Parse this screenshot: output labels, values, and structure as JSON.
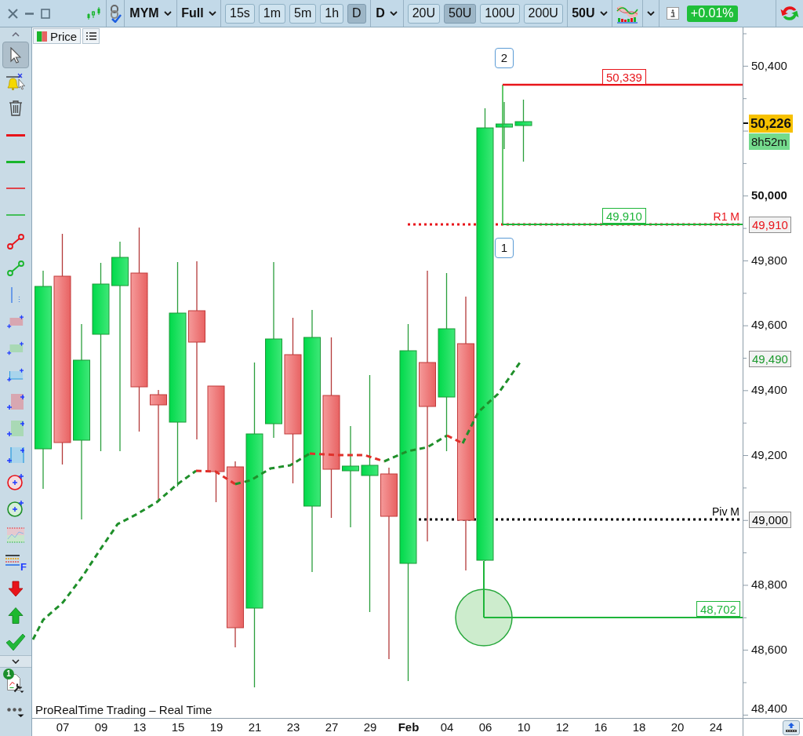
{
  "toolbar": {
    "instrument": "MYM",
    "view": "Full",
    "intervals": [
      {
        "label": "15s",
        "selected": false
      },
      {
        "label": "1m",
        "selected": false
      },
      {
        "label": "5m",
        "selected": false
      },
      {
        "label": "1h",
        "selected": false
      },
      {
        "label": "D",
        "selected": true
      }
    ],
    "period": "D",
    "units": [
      {
        "label": "20U",
        "selected": false
      },
      {
        "label": "50U",
        "selected": true
      },
      {
        "label": "100U",
        "selected": false
      },
      {
        "label": "200U",
        "selected": false
      }
    ],
    "unit_count": "50U",
    "change": "+0.01%"
  },
  "chart_tab": {
    "label": "Price"
  },
  "drawing_tools": [
    {
      "selected": true
    },
    {
      "selected": false
    },
    {
      "selected": false
    },
    {
      "selected": false
    },
    {
      "selected": false
    },
    {
      "selected": false
    },
    {
      "selected": false
    },
    {
      "selected": false
    },
    {
      "selected": false
    },
    {
      "selected": false
    },
    {
      "selected": false
    },
    {
      "selected": false
    },
    {
      "selected": false
    },
    {
      "selected": false
    },
    {
      "selected": false
    },
    {
      "selected": false
    },
    {
      "selected": false
    },
    {
      "selected": false
    },
    {
      "selected": false
    },
    {
      "selected": false,
      "glyph": "F"
    },
    {
      "selected": false
    },
    {
      "selected": false
    },
    {
      "selected": false
    }
  ],
  "settings_badge": "1",
  "chart": {
    "legend": "ProRealTime Trading – Real Time",
    "price_axis": [
      {
        "label": "50,400",
        "bold": false
      },
      {
        "label": "50,000",
        "bold": true
      },
      {
        "label": "49,800",
        "bold": false
      },
      {
        "label": "49,600",
        "bold": false
      },
      {
        "label": "49,400",
        "bold": false
      },
      {
        "label": "49,200",
        "bold": false
      },
      {
        "label": "48,800",
        "bold": false
      },
      {
        "label": "48,600",
        "bold": false
      },
      {
        "label": "48,400",
        "bold": false
      }
    ],
    "date_axis": [
      {
        "label": "07",
        "bold": false
      },
      {
        "label": "09",
        "bold": false
      },
      {
        "label": "13",
        "bold": false
      },
      {
        "label": "15",
        "bold": false
      },
      {
        "label": "19",
        "bold": false
      },
      {
        "label": "21",
        "bold": false
      },
      {
        "label": "23",
        "bold": false
      },
      {
        "label": "27",
        "bold": false
      },
      {
        "label": "29",
        "bold": false
      },
      {
        "label": "Feb",
        "bold": true
      },
      {
        "label": "04",
        "bold": false
      },
      {
        "label": "06",
        "bold": false
      },
      {
        "label": "10",
        "bold": false
      },
      {
        "label": "12",
        "bold": false
      },
      {
        "label": "16",
        "bold": false
      },
      {
        "label": "18",
        "bold": false
      },
      {
        "label": "20",
        "bold": false
      },
      {
        "label": "24",
        "bold": false
      }
    ],
    "last_price": {
      "price": "50,226",
      "countdown": "8h52m"
    },
    "pivots": [
      {
        "label": "R1 M",
        "price": "49,910",
        "color": "#e8141a"
      },
      {
        "label": "Piv M",
        "price": "49,000",
        "color": "#000000"
      }
    ],
    "moving_average": {
      "price": "49,490"
    },
    "level_lines": [
      {
        "price": "50,339",
        "color": "#e8141a"
      },
      {
        "price": "49,910",
        "color": "#1eb53a"
      },
      {
        "price": "48,702",
        "color": "#1eb53a"
      }
    ],
    "point_labels": [
      "2",
      "1"
    ]
  }
}
